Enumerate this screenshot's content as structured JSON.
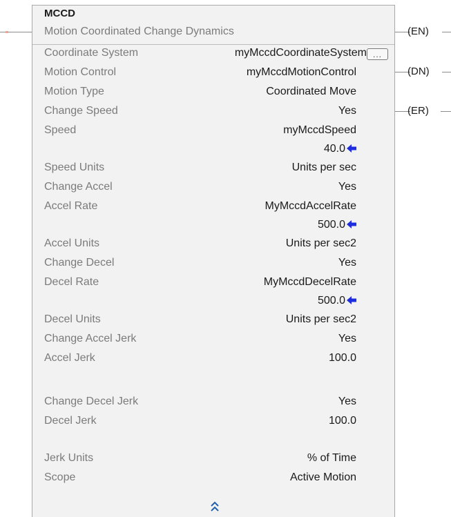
{
  "instruction": {
    "mnemonic": "MCCD",
    "description": "Motion Coordinated Change Dynamics",
    "browse_button_label": "...",
    "rows": [
      {
        "label": "Coordinate System",
        "value": "myMccdCoordinateSystem",
        "live": ""
      },
      {
        "label": "Motion Control",
        "value": "myMccdMotionControl",
        "live": ""
      },
      {
        "label": "Motion Type",
        "value": "Coordinated Move",
        "live": ""
      },
      {
        "label": "Change Speed",
        "value": "Yes",
        "live": ""
      },
      {
        "label": "Speed",
        "value": "myMccdSpeed",
        "live": "40.0"
      },
      {
        "label": "Speed Units",
        "value": "Units per sec",
        "live": ""
      },
      {
        "label": "Change Accel",
        "value": "Yes",
        "live": ""
      },
      {
        "label": "Accel Rate",
        "value": "MyMccdAccelRate",
        "live": "500.0"
      },
      {
        "label": "Accel Units",
        "value": "Units per sec2",
        "live": ""
      },
      {
        "label": "Change Decel",
        "value": "Yes",
        "live": ""
      },
      {
        "label": "Decel Rate",
        "value": "MyMccdDecelRate",
        "live": "500.0"
      },
      {
        "label": "Decel Units",
        "value": "Units per sec2",
        "live": ""
      },
      {
        "label": "Change Accel Jerk",
        "value": "Yes",
        "live": ""
      },
      {
        "label": "Accel Jerk",
        "value": "100.0",
        "live": ""
      },
      {
        "label": "Change Decel Jerk",
        "value": "Yes",
        "live": ""
      },
      {
        "label": "Decel Jerk",
        "value": "100.0",
        "live": ""
      },
      {
        "label": "Jerk Units",
        "value": "% of Time",
        "live": ""
      },
      {
        "label": "Scope",
        "value": "Active Motion",
        "live": ""
      }
    ]
  },
  "outputs": {
    "en": "EN",
    "dn": "DN",
    "er": "ER"
  },
  "colors": {
    "live_value_arrow": "#1f2de0",
    "label_text": "#7b7b7b",
    "value_text": "#1a1a1a",
    "block_fill": "#f2f2f2"
  },
  "icons": {
    "live_value_marker": "left-arrow-icon",
    "collapse": "double-chevron-up-icon"
  }
}
